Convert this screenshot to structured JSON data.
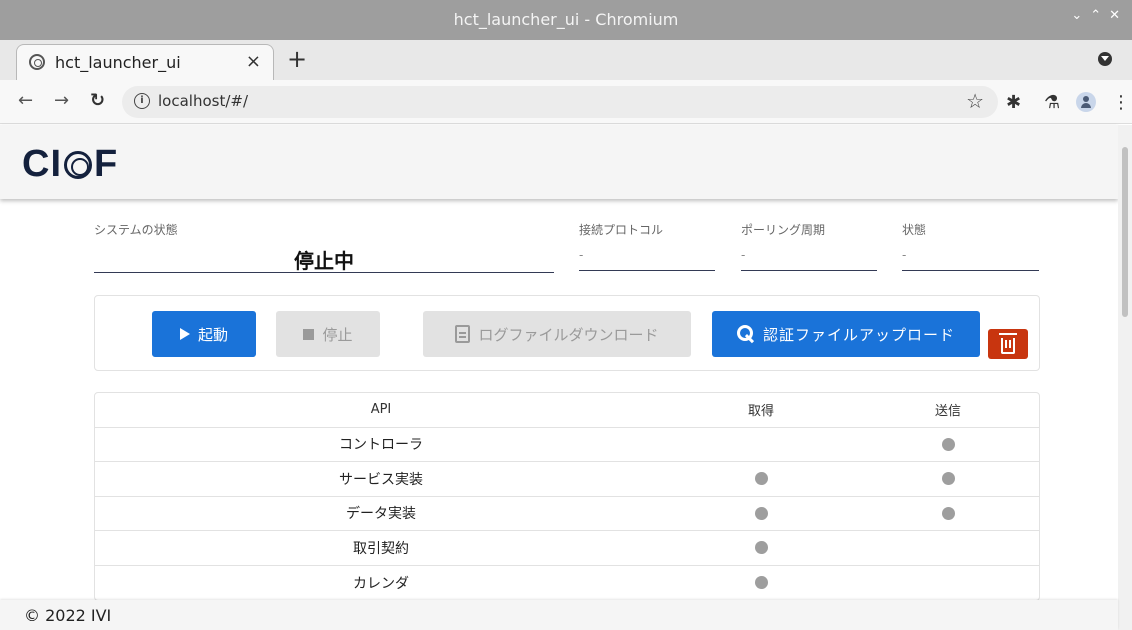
{
  "window": {
    "title": "hct_launcher_ui - Chromium"
  },
  "browser": {
    "tab_title": "hct_launcher_ui",
    "tab_close": "×",
    "new_tab": "+",
    "url": "localhost/#/"
  },
  "app": {
    "logo": {
      "left": "CI",
      "right": "F"
    },
    "status": {
      "system_state_label": "システムの状態",
      "system_state_value": "停止中",
      "protocol_label": "接続プロトコル",
      "protocol_value": "-",
      "polling_label": "ポーリング周期",
      "polling_value": "-",
      "state_label": "状態",
      "state_value": "-"
    },
    "buttons": {
      "start": "起動",
      "stop": "停止",
      "log_download": "ログファイルダウンロード",
      "cert_upload": "認証ファイルアップロード"
    },
    "colors": {
      "primary": "#1a73d9",
      "danger": "#c8350f",
      "disabled": "#e2e2e2",
      "dot": "#9e9e9e"
    },
    "table": {
      "headers": {
        "api": "API",
        "get": "取得",
        "send": "送信"
      },
      "rows": [
        {
          "api": "コントローラ",
          "get": false,
          "send": true
        },
        {
          "api": "サービス実装",
          "get": true,
          "send": true
        },
        {
          "api": "データ実装",
          "get": true,
          "send": true
        },
        {
          "api": "取引契約",
          "get": true,
          "send": false
        },
        {
          "api": "カレンダ",
          "get": true,
          "send": false
        }
      ]
    },
    "footer": {
      "copyright": "© 2022 IVI"
    }
  }
}
